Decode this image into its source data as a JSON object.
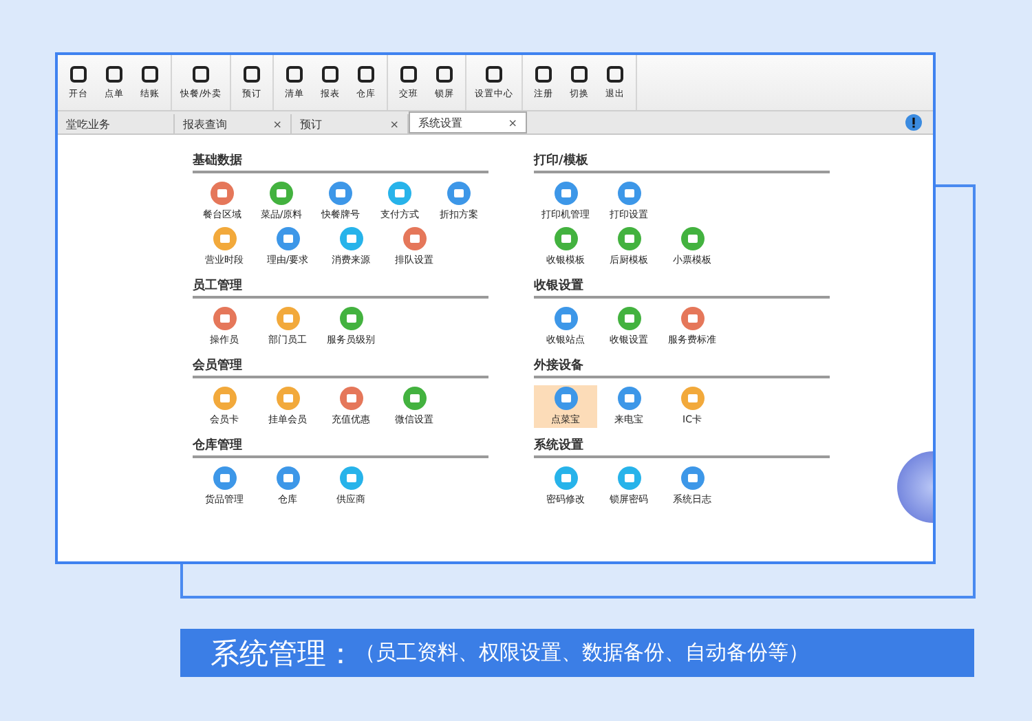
{
  "toolbar": [
    [
      {
        "label": "开台"
      },
      {
        "label": "点单"
      },
      {
        "label": "结账"
      }
    ],
    [
      {
        "label": "快餐/外卖"
      }
    ],
    [
      {
        "label": "预订"
      }
    ],
    [
      {
        "label": "清单"
      },
      {
        "label": "报表"
      },
      {
        "label": "仓库"
      }
    ],
    [
      {
        "label": "交班"
      },
      {
        "label": "锁屏"
      }
    ],
    [
      {
        "label": "设置中心"
      }
    ],
    [
      {
        "label": "注册"
      },
      {
        "label": "切换"
      },
      {
        "label": "退出"
      }
    ]
  ],
  "tabs": [
    {
      "label": "堂吃业务",
      "selected": false
    },
    {
      "label": "报表查询",
      "close": "×",
      "selected": false
    },
    {
      "label": "预订",
      "close": "×",
      "selected": false
    },
    {
      "label": "系统设置",
      "close": "×",
      "selected": true
    }
  ],
  "columns": [
    [
      {
        "title": "基础数据",
        "rows": [
          [
            {
              "label": "餐台区域",
              "color": "#e5775a",
              "selected": false
            },
            {
              "label": "菜品/原料",
              "color": "#43b23f",
              "selected": false
            },
            {
              "label": "快餐牌号",
              "color": "#3d97e8",
              "selected": false
            },
            {
              "label": "支付方式",
              "color": "#27b3ea",
              "selected": false
            },
            {
              "label": "折扣方案",
              "color": "#3d97e8",
              "selected": false
            }
          ],
          [
            {
              "label": "营业时段",
              "color": "#f2a93b",
              "selected": false
            },
            {
              "label": "理由/要求",
              "color": "#3d97e8",
              "selected": false
            },
            {
              "label": "消费来源",
              "color": "#27b3ea",
              "selected": false
            },
            {
              "label": "排队设置",
              "color": "#e5775a",
              "selected": false
            }
          ]
        ]
      },
      {
        "title": "员工管理",
        "rows": [
          [
            {
              "label": "操作员",
              "color": "#e5775a",
              "selected": false
            },
            {
              "label": "部门员工",
              "color": "#f2a93b",
              "selected": false
            },
            {
              "label": "服务员级别",
              "color": "#43b23f",
              "selected": false
            }
          ]
        ]
      },
      {
        "title": "会员管理",
        "rows": [
          [
            {
              "label": "会员卡",
              "color": "#f2a93b",
              "selected": false
            },
            {
              "label": "挂单会员",
              "color": "#f2a93b",
              "selected": false
            },
            {
              "label": "充值优惠",
              "color": "#e5775a",
              "selected": false
            },
            {
              "label": "微信设置",
              "color": "#43b23f",
              "selected": false
            }
          ]
        ]
      },
      {
        "title": "仓库管理",
        "rows": [
          [
            {
              "label": "货品管理",
              "color": "#3d97e8",
              "selected": false
            },
            {
              "label": "仓库",
              "color": "#3d97e8",
              "selected": false
            },
            {
              "label": "供应商",
              "color": "#27b3ea",
              "selected": false
            }
          ]
        ]
      }
    ],
    [
      {
        "title": "打印/模板",
        "rows": [
          [
            {
              "label": "打印机管理",
              "color": "#3d97e8",
              "selected": false
            },
            {
              "label": "打印设置",
              "color": "#3d97e8",
              "selected": false
            }
          ],
          [
            {
              "label": "收银模板",
              "color": "#43b23f",
              "selected": false
            },
            {
              "label": "后厨模板",
              "color": "#43b23f",
              "selected": false
            },
            {
              "label": "小票模板",
              "color": "#43b23f",
              "selected": false
            }
          ]
        ]
      },
      {
        "title": "收银设置",
        "rows": [
          [
            {
              "label": "收银站点",
              "color": "#3d97e8",
              "selected": false
            },
            {
              "label": "收银设置",
              "color": "#43b23f",
              "selected": false
            },
            {
              "label": "服务费标准",
              "color": "#e5775a",
              "selected": false
            }
          ]
        ]
      },
      {
        "title": "外接设备",
        "rows": [
          [
            {
              "label": "点菜宝",
              "color": "#3d97e8",
              "selected": true
            },
            {
              "label": "来电宝",
              "color": "#3d97e8",
              "selected": false
            },
            {
              "label": "IC卡",
              "color": "#f2a93b",
              "selected": false
            }
          ]
        ]
      },
      {
        "title": "系统设置",
        "rows": [
          [
            {
              "label": "密码修改",
              "color": "#27b3ea",
              "selected": false
            },
            {
              "label": "锁屏密码",
              "color": "#27b3ea",
              "selected": false
            },
            {
              "label": "系统日志",
              "color": "#3d97e8",
              "selected": false
            }
          ]
        ]
      }
    ]
  ],
  "banner": {
    "title": "系统管理：",
    "subtitle": "（员工资料、权限设置、数据备份、自动备份等）"
  }
}
